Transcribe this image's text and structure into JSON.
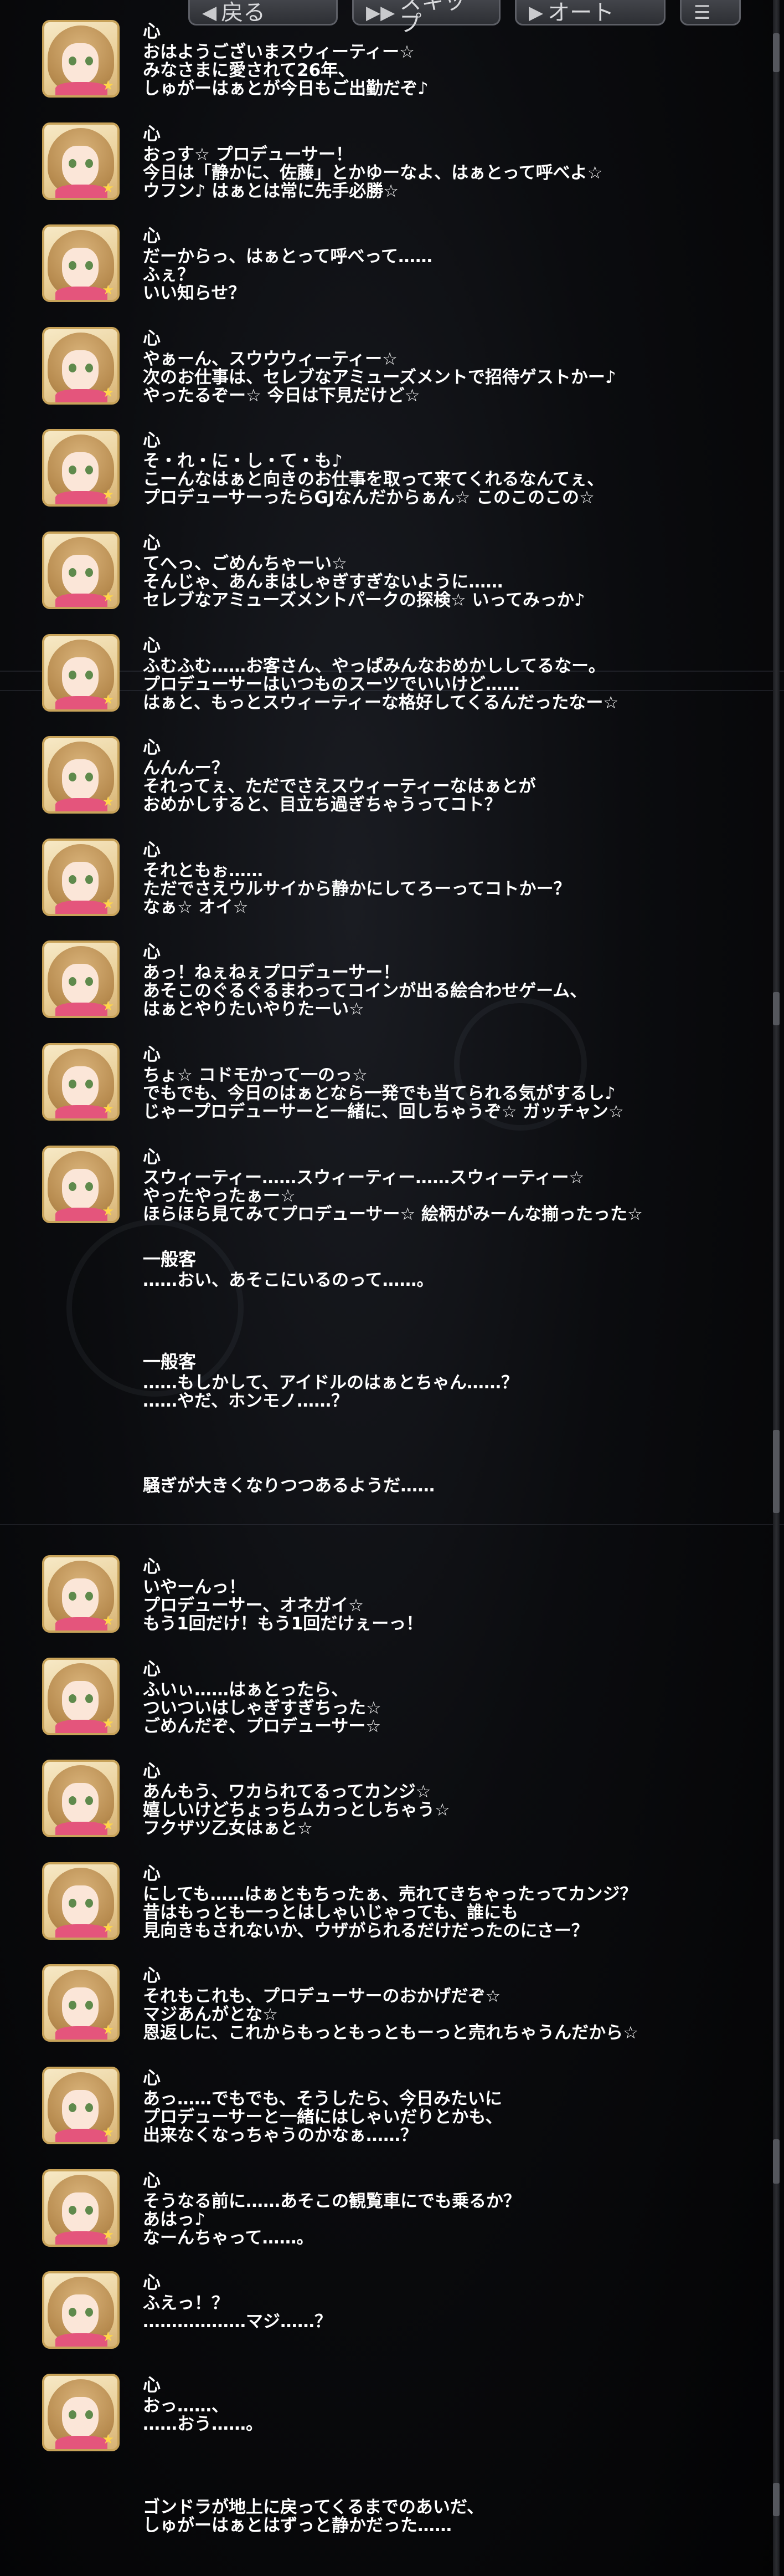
{
  "toolbar": {
    "back_label": "戻る",
    "skip_label": "スキップ",
    "auto_label": "オート"
  },
  "avatar_icon": "idol-portrait-icon",
  "entries": [
    {
      "speaker": "心",
      "lines": [
        "おはようございまスウィーティー☆",
        "みなさまに愛されて26年、",
        "しゅがーはぁとが今日もご出勤だぞ♪"
      ]
    },
    {
      "speaker": "心",
      "lines": [
        "おっす☆ プロデューサー！",
        "今日は「静かに、佐藤」とかゆーなよ、はぁとって呼べよ☆",
        "ウフン♪ はぁとは常に先手必勝☆"
      ]
    },
    {
      "speaker": "心",
      "lines": [
        "だーからっ、はぁとって呼べって……",
        "ふぇ？",
        "いい知らせ？"
      ]
    },
    {
      "speaker": "心",
      "lines": [
        "やぁーん、スウウウィーティー☆",
        "次のお仕事は、セレブなアミューズメントで招待ゲストかー♪",
        "やったるぞー☆ 今日は下見だけど☆"
      ]
    },
    {
      "speaker": "心",
      "lines": [
        "そ・れ・に・し・て・も♪",
        "こーんなはぁと向きのお仕事を取って来てくれるなんてぇ、",
        "プロデューサーったらGJなんだからぁん☆ このこのこの☆"
      ]
    },
    {
      "speaker": "心",
      "lines": [
        "てへっ、ごめんちゃーい☆",
        "そんじゃ、あんまはしゃぎすぎないように……",
        "セレブなアミューズメントパークの探検☆ いってみっか♪"
      ]
    },
    {
      "speaker": "心",
      "lines": [
        "ふむふむ……お客さん、やっぱみんなおめかししてるなー。",
        "プロデューサーはいつものスーツでいいけど……",
        "はぁと、もっとスウィーティーな格好してくるんだったなー☆"
      ]
    },
    {
      "speaker": "心",
      "lines": [
        "んんんー？",
        "それってぇ、ただでさえスウィーティーなはぁとが",
        "おめかしすると、目立ち過ぎちゃうってコト？"
      ]
    },
    {
      "speaker": "心",
      "lines": [
        "それともぉ……",
        "ただでさえウルサイから静かにしてろーってコトかー？",
        "なぁ☆ オイ☆"
      ]
    },
    {
      "speaker": "心",
      "lines": [
        "あっ！ねぇねぇプロデューサー！",
        "あそこのぐるぐるまわってコインが出る絵合わせゲーム、",
        "はぁとやりたいやりたーい☆"
      ]
    },
    {
      "speaker": "心",
      "lines": [
        "ちょ☆ コドモかって一のっ☆",
        "でもでも、今日のはぁとなら一発でも当てられる気がするし♪",
        "じゃープロデューサーと一緒に、回しちゃうぞ☆ ガッチャン☆"
      ]
    },
    {
      "speaker": "心",
      "lines": [
        "スウィーティー……スウィーティー……スウィーティー☆",
        "やったやったぁー☆",
        "ほらほら見てみてプロデューサー☆ 絵柄がみーんな揃ったった☆"
      ]
    }
  ],
  "crowd": [
    {
      "speaker": "一般客",
      "lines": [
        "……おい、あそこにいるのって……。"
      ]
    },
    {
      "speaker": "一般客",
      "lines": [
        "……もしかして、アイドルのはぁとちゃん……？",
        "……やだ、ホンモノ……？"
      ]
    }
  ],
  "narration_1": "騒ぎが大きくなりつつあるようだ……",
  "entries2": [
    {
      "speaker": "心",
      "lines": [
        "いやーんっ！",
        "プロデューサー、オネガイ☆",
        "もう1回だけ！もう1回だけぇーっ！"
      ]
    },
    {
      "speaker": "心",
      "lines": [
        "ふいぃ……はぁとったら、",
        "ついついはしゃぎすぎちった☆",
        "ごめんだぞ、プロデューサー☆"
      ]
    },
    {
      "speaker": "心",
      "lines": [
        "あんもう、ワカられてるってカンジ☆",
        "嬉しいけどちょっちムカっとしちゃう☆",
        "フクザツ乙女はぁと☆"
      ]
    },
    {
      "speaker": "心",
      "lines": [
        "にしても……はぁともちったぁ、売れてきちゃったってカンジ？",
        "昔はもっとも一っとはしゃいじゃっても、誰にも",
        "見向きもされないか、ウザがられるだけだったのにさー？"
      ]
    },
    {
      "speaker": "心",
      "lines": [
        "それもこれも、プロデューサーのおかげだぞ☆",
        "マジあんがとな☆",
        "恩返しに、これからもっともっともーっと売れちゃうんだから☆"
      ]
    },
    {
      "speaker": "心",
      "lines": [
        "あっ……でもでも、そうしたら、今日みたいに",
        "プロデューサーと一緒にはしゃいだりとかも、",
        "出来なくなっちゃうのかなぁ……？"
      ]
    },
    {
      "speaker": "心",
      "lines": [
        "そうなる前に……あそこの観覧車にでも乗るか？",
        "あはっ♪",
        "なーんちゃって……。"
      ]
    },
    {
      "speaker": "心",
      "lines": [
        "ふえっ！？",
        "………………マジ……？"
      ]
    },
    {
      "speaker": "心",
      "lines": [
        "おっ……、",
        "……おう……。"
      ]
    }
  ],
  "narration_2": [
    "ゴンドラが地上に戻ってくるまでのあいだ、",
    "しゅがーはぁとはずっと静かだった……"
  ]
}
